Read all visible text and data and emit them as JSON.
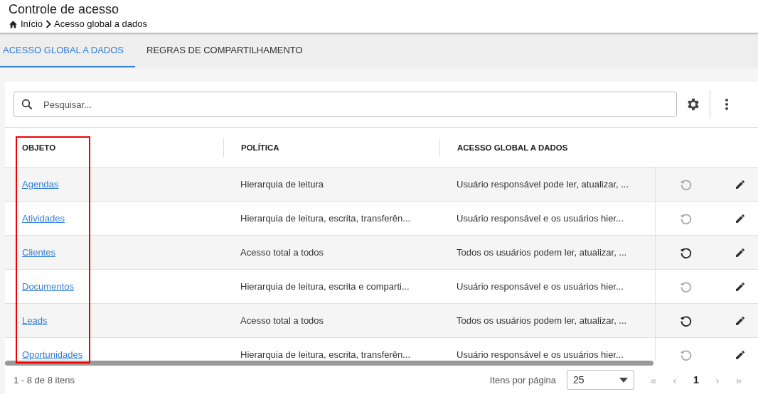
{
  "header": {
    "title": "Controle de acesso",
    "breadcrumb": [
      "Início",
      "Acesso global a dados"
    ]
  },
  "tabs": [
    {
      "label": "ACESSO GLOBAL A DADOS",
      "selected": true
    },
    {
      "label": "REGRAS DE COMPARTILHAMENTO",
      "selected": false
    }
  ],
  "search": {
    "placeholder": "Pesquisar..."
  },
  "table": {
    "columns": [
      "OBJETO",
      "POLÍTICA",
      "ACESSO GLOBAL A DADOS"
    ],
    "highlight": {
      "kind": "frame"
    },
    "rows": [
      {
        "object": "Agendas",
        "policy": "Hierarquia de leitura",
        "access": "Usuário responsável pode ler, atualizar, ...",
        "reset_enabled": false
      },
      {
        "object": "Atividades",
        "policy": "Hierarquia de leitura, escrita, transferên...",
        "access": "Usuário responsável e os usuários hier...",
        "reset_enabled": false
      },
      {
        "object": "Clientes",
        "policy": "Acesso total a todos",
        "access": "Todos os usuários podem ler, atualizar, ...",
        "reset_enabled": true
      },
      {
        "object": "Documentos",
        "policy": "Hierarquia de leitura, escrita e comparti...",
        "access": "Usuário responsável e os usuários hier...",
        "reset_enabled": false
      },
      {
        "object": "Leads",
        "policy": "Acesso total a todos",
        "access": "Todos os usuários podem ler, atualizar, ...",
        "reset_enabled": true
      },
      {
        "object": "Oportunidades",
        "policy": "Hierarquia de leitura, escrita, transferên...",
        "access": "Usuário responsável e os usuários hier...",
        "reset_enabled": false
      }
    ]
  },
  "footer": {
    "count": "1 - 8 de 8 itens",
    "page_size_label": "Itens por página",
    "page_size": "25",
    "first": "«",
    "previous": "‹",
    "pages": [
      {
        "label": "1",
        "selected": true
      }
    ],
    "next": "›",
    "last": "»"
  }
}
